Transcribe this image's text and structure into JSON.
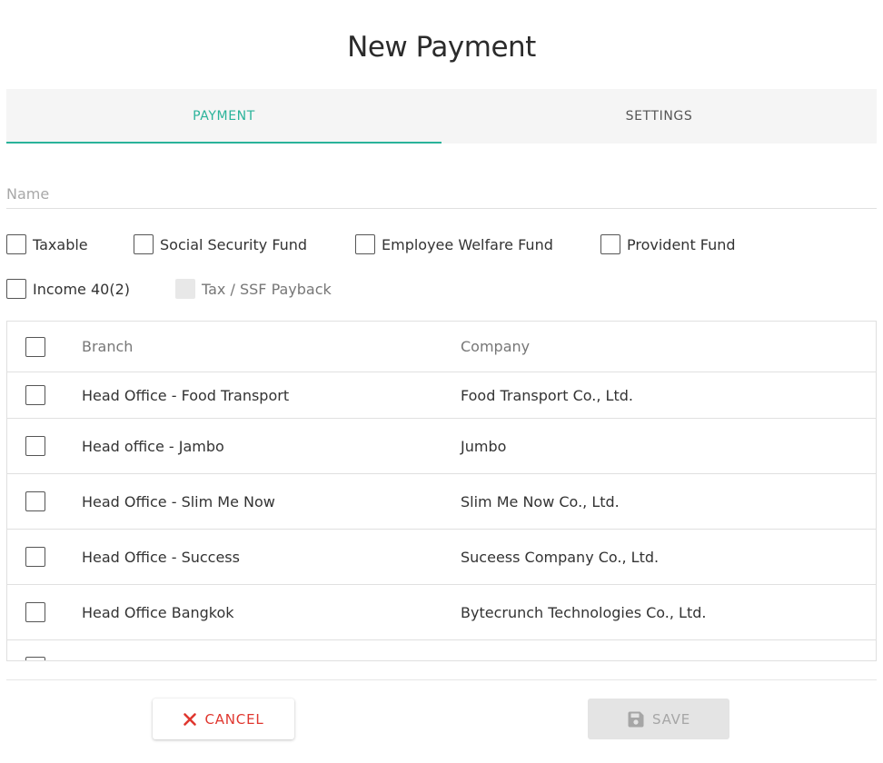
{
  "page": {
    "title": "New Payment"
  },
  "tabs": [
    {
      "label": "PAYMENT",
      "active": true
    },
    {
      "label": "SETTINGS",
      "active": false
    }
  ],
  "form": {
    "name": {
      "value": "",
      "placeholder": "Name"
    },
    "options": [
      {
        "label": "Taxable",
        "checked": false,
        "disabled": false
      },
      {
        "label": "Social Security Fund",
        "checked": false,
        "disabled": false
      },
      {
        "label": "Employee Welfare Fund",
        "checked": false,
        "disabled": false
      },
      {
        "label": "Provident Fund",
        "checked": false,
        "disabled": false
      },
      {
        "label": "Income 40(2)",
        "checked": false,
        "disabled": false
      },
      {
        "label": "Tax / SSF Payback",
        "checked": false,
        "disabled": true
      }
    ]
  },
  "table": {
    "headers": {
      "branch": "Branch",
      "company": "Company"
    },
    "rows": [
      {
        "branch": "Head Office - Food Transport",
        "company": "Food Transport Co., Ltd."
      },
      {
        "branch": "Head office - Jambo",
        "company": "Jumbo"
      },
      {
        "branch": "Head Office - Slim Me Now",
        "company": "Slim Me Now Co., Ltd."
      },
      {
        "branch": "Head Office - Success",
        "company": "Suceess Company Co., Ltd."
      },
      {
        "branch": "Head Office Bangkok",
        "company": "Bytecrunch Technologies Co., Ltd."
      }
    ]
  },
  "actions": {
    "cancel_label": "CANCEL",
    "save_label": "SAVE"
  },
  "colors": {
    "accent": "#2ab39a",
    "danger": "#e0372f",
    "disabled": "#a6a6a6"
  },
  "icons": {
    "cancel": "close-icon",
    "save": "floppy-disk-icon"
  }
}
